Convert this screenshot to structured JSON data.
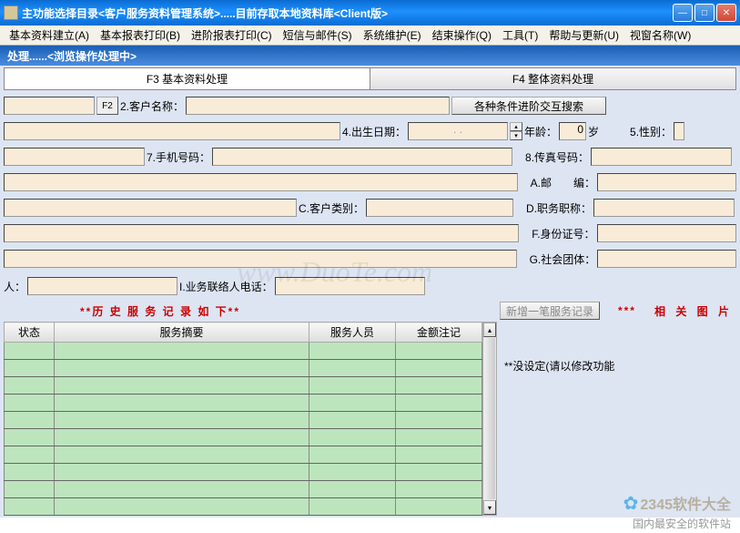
{
  "window": {
    "title": "主功能选择目录<客户服务资料管理系统>.....目前存取本地资料库<Client版>"
  },
  "menu": {
    "items": [
      "基本资料建立(A)",
      "基本报表打印(B)",
      "进阶报表打印(C)",
      "短信与邮件(S)",
      "系统维护(E)",
      "结束操作(Q)",
      "工具(T)",
      "帮助与更新(U)",
      "视窗名称(W)"
    ]
  },
  "status": "处理......<浏览操作处理中>",
  "tabs": {
    "tab1": "F3 基本资料处理",
    "tab2": "F4 整体资料处理"
  },
  "labels": {
    "f2": "F2",
    "custname": "2.客户名称：",
    "advsearch": "各种条件进阶交互搜索",
    "birth": "4.出生日期：",
    "birthval": ". .",
    "age_pre": "年龄：",
    "age_val": "0",
    "age_suf": "岁",
    "sex": "5.性别：",
    "mobile": "7.手机号码：",
    "fax": "8.传真号码：",
    "zip": "A.邮　　编：",
    "custtype": "C.客户类别：",
    "title": "D.职务职称：",
    "idcard": "F.身份证号：",
    "org": "G.社会团体：",
    "contact_prefix": "人：",
    "contacttel": "I.业务联络人电话：",
    "history": "**历 史 服 务 记 录 如 下**",
    "addrec": "新增一笔服务记录",
    "stars": "***",
    "related": "相 关 图 片",
    "noset": "**没设定(请以修改功能"
  },
  "grid": {
    "cols": [
      "状态",
      "服务摘要",
      "服务人员",
      "金额注记"
    ]
  },
  "footer": {
    "brand": "2345软件大全",
    "slogan": "国内最安全的软件站"
  },
  "watermark": "www.DuoTe.com"
}
